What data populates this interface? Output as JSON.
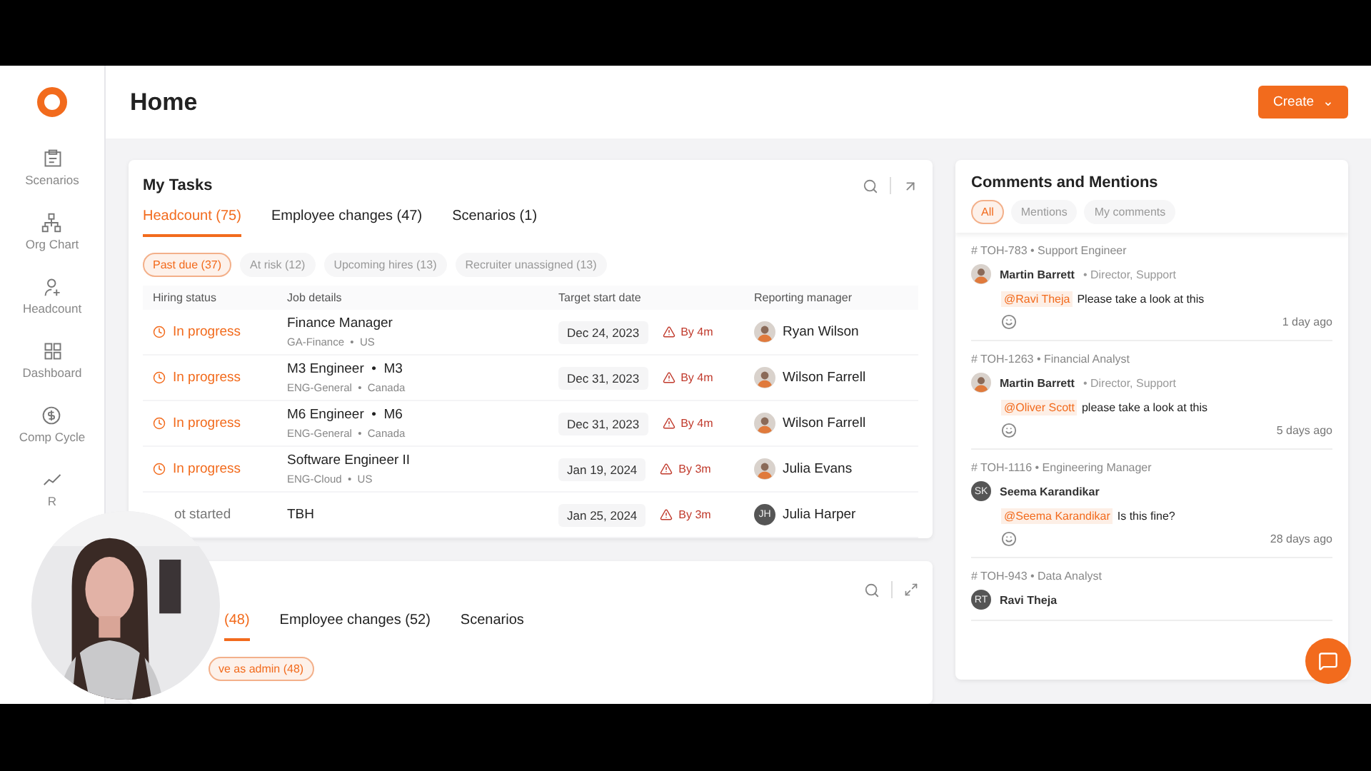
{
  "page": {
    "title": "Home",
    "create_button": "Create",
    "create_caret": "⌄"
  },
  "sidebar": {
    "items": [
      {
        "label": "Scenarios",
        "kind": "scenarios"
      },
      {
        "label": "Org Chart",
        "kind": "org"
      },
      {
        "label": "Headcount",
        "kind": "headcount"
      },
      {
        "label": "Dashboard",
        "kind": "dashboard"
      },
      {
        "label": "Comp Cycle",
        "kind": "comp"
      },
      {
        "label": "R",
        "kind": "chart"
      }
    ]
  },
  "my_tasks": {
    "title": "My Tasks",
    "tabs": [
      {
        "label": "Headcount (75)",
        "selected": true
      },
      {
        "label": "Employee changes (47)",
        "selected": false
      },
      {
        "label": "Scenarios (1)",
        "selected": false
      }
    ],
    "filters": [
      {
        "label": "Past due (37)",
        "selected": true
      },
      {
        "label": "At risk (12)",
        "selected": false
      },
      {
        "label": "Upcoming hires (13)",
        "selected": false
      },
      {
        "label": "Recruiter unassigned (13)",
        "selected": false
      }
    ],
    "columns": [
      "Hiring status",
      "Job details",
      "Target start date",
      "Reporting manager"
    ],
    "rows": [
      {
        "status": "In progress",
        "kind": "in_progress",
        "title": "Finance Manager",
        "subtitle": "GA-Finance  •  US",
        "date": "Dec 24, 2023",
        "risk": "By 4m",
        "manager": "Ryan Wilson"
      },
      {
        "status": "In progress",
        "kind": "in_progress",
        "title": "M3 Engineer  •  M3",
        "subtitle": "ENG-General  •  Canada",
        "date": "Dec 31, 2023",
        "risk": "By 4m",
        "manager": "Wilson Farrell"
      },
      {
        "status": "In progress",
        "kind": "in_progress",
        "title": "M6 Engineer  •  M6",
        "subtitle": "ENG-General  •  Canada",
        "date": "Dec 31, 2023",
        "risk": "By 4m",
        "manager": "Wilson Farrell"
      },
      {
        "status": "In progress",
        "kind": "in_progress",
        "title": "Software Engineer II",
        "subtitle": "ENG-Cloud  •  US",
        "date": "Jan 19, 2024",
        "risk": "By 3m",
        "manager": "Julia Evans"
      },
      {
        "status": "ot started",
        "kind": "not_started",
        "title": "TBH",
        "date": "Jan 25, 2024",
        "risk": "By 3m",
        "manager": "Julia Harper",
        "avatar": {
          "kind": "initials",
          "initials": "JH"
        }
      }
    ]
  },
  "second_card": {
    "tabs": [
      {
        "label": "(48)",
        "selected": true
      },
      {
        "label": "Employee changes (52)",
        "selected": false
      },
      {
        "label": "Scenarios",
        "selected": false
      }
    ],
    "filters": [
      {
        "label": "ve as admin (48)",
        "selected": true
      }
    ]
  },
  "comments": {
    "title": "Comments and Mentions",
    "tabs": [
      {
        "label": "All",
        "selected": true
      },
      {
        "label": "Mentions",
        "selected": false
      },
      {
        "label": "My comments",
        "selected": false
      }
    ],
    "items": [
      {
        "ref": "# TOH-783 • Support Engineer",
        "author": "Martin Barrett",
        "author_role": "• Director, Support",
        "mention": "@Ravi Theja",
        "text": "Please take a look at this",
        "time": "1 day ago"
      },
      {
        "ref": "# TOH-1263 • Financial Analyst",
        "author": "Martin Barrett",
        "author_role": "• Director, Support",
        "mention": "@Oliver Scott",
        "text": "please take a look at this",
        "time": "5 days ago"
      },
      {
        "ref": "# TOH-1116 • Engineering Manager",
        "author": "Seema Karandikar",
        "avatar": {
          "kind": "initials",
          "initials": "SK"
        },
        "mention": "@Seema Karandikar",
        "text": "Is this fine?",
        "time": "28 days ago"
      },
      {
        "ref": "# TOH-943 • Data Analyst",
        "author": "Ravi Theja",
        "avatar": {
          "kind": "initials",
          "initials": "RT"
        }
      }
    ]
  }
}
